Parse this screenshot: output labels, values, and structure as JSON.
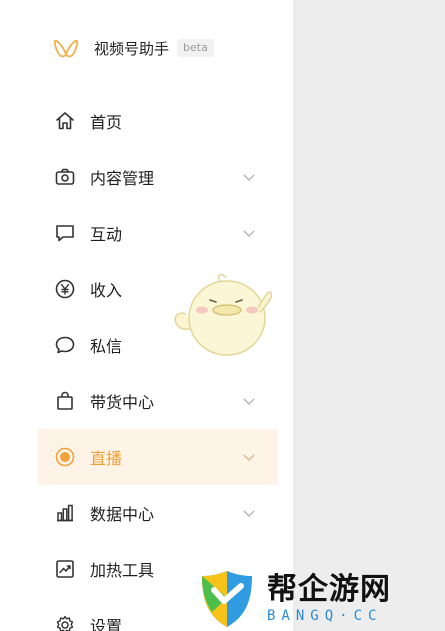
{
  "brand": {
    "title": "视频号助手",
    "badge": "beta",
    "logo_icon": "butterfly-logo",
    "accent_color": "#f0a23a"
  },
  "menu": {
    "items": [
      {
        "label": "首页",
        "icon": "home-icon",
        "has_chevron": false,
        "active": false
      },
      {
        "label": "内容管理",
        "icon": "camera-icon",
        "has_chevron": true,
        "active": false
      },
      {
        "label": "互动",
        "icon": "chat-box-icon",
        "has_chevron": true,
        "active": false
      },
      {
        "label": "收入",
        "icon": "yen-circle-icon",
        "has_chevron": false,
        "active": false
      },
      {
        "label": "私信",
        "icon": "speech-bubble-icon",
        "has_chevron": false,
        "active": false
      },
      {
        "label": "带货中心",
        "icon": "shopping-bag-icon",
        "has_chevron": true,
        "active": false
      },
      {
        "label": "直播",
        "icon": "live-dot-icon",
        "has_chevron": true,
        "active": true
      },
      {
        "label": "数据中心",
        "icon": "bar-chart-icon",
        "has_chevron": true,
        "active": false
      },
      {
        "label": "加热工具",
        "icon": "trend-chart-icon",
        "has_chevron": false,
        "active": false
      },
      {
        "label": "设置",
        "icon": "gear-icon",
        "has_chevron": false,
        "active": false
      }
    ]
  },
  "watermark": {
    "cn": "帮企游网",
    "en": "BANGQ·CC"
  },
  "colors": {
    "active_bg": "#fdf3e7",
    "right_pane_bg": "#ededed"
  }
}
